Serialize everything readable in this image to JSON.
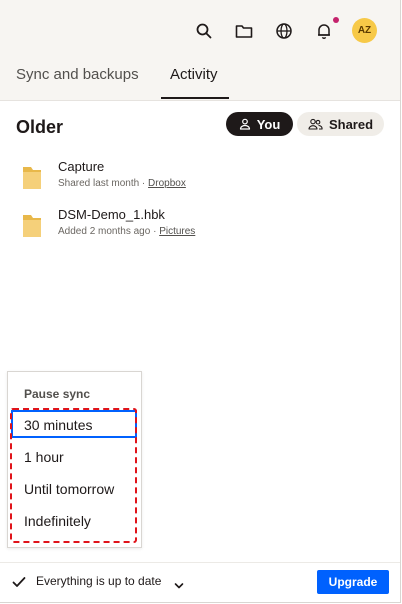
{
  "header": {
    "avatar_initials": "AZ",
    "icons": [
      "search-icon",
      "folder-icon",
      "globe-icon",
      "bell-icon"
    ],
    "notification_dot_color": "#c4226c"
  },
  "tabs": [
    {
      "label": "Sync and backups",
      "active": false
    },
    {
      "label": "Activity",
      "active": true
    }
  ],
  "section": {
    "title": "Older",
    "filters": [
      {
        "label": "You",
        "selected": true
      },
      {
        "label": "Shared",
        "selected": false
      }
    ]
  },
  "files": [
    {
      "name": "Capture",
      "meta_prefix": "Shared last month · ",
      "location": "Dropbox"
    },
    {
      "name": "DSM-Demo_1.hbk",
      "meta_prefix": "Added 2 months ago · ",
      "location": "Pictures"
    }
  ],
  "pause_menu": {
    "title": "Pause sync",
    "options": [
      "30 minutes",
      "1 hour",
      "Until tomorrow",
      "Indefinitely"
    ],
    "selected": "30 minutes"
  },
  "status": {
    "text": "Everything is up to date",
    "upgrade_label": "Upgrade"
  },
  "colors": {
    "accent": "#0061fe",
    "highlight": "#e0131a",
    "avatar": "#f7c948",
    "folder": "#f5d07a"
  }
}
